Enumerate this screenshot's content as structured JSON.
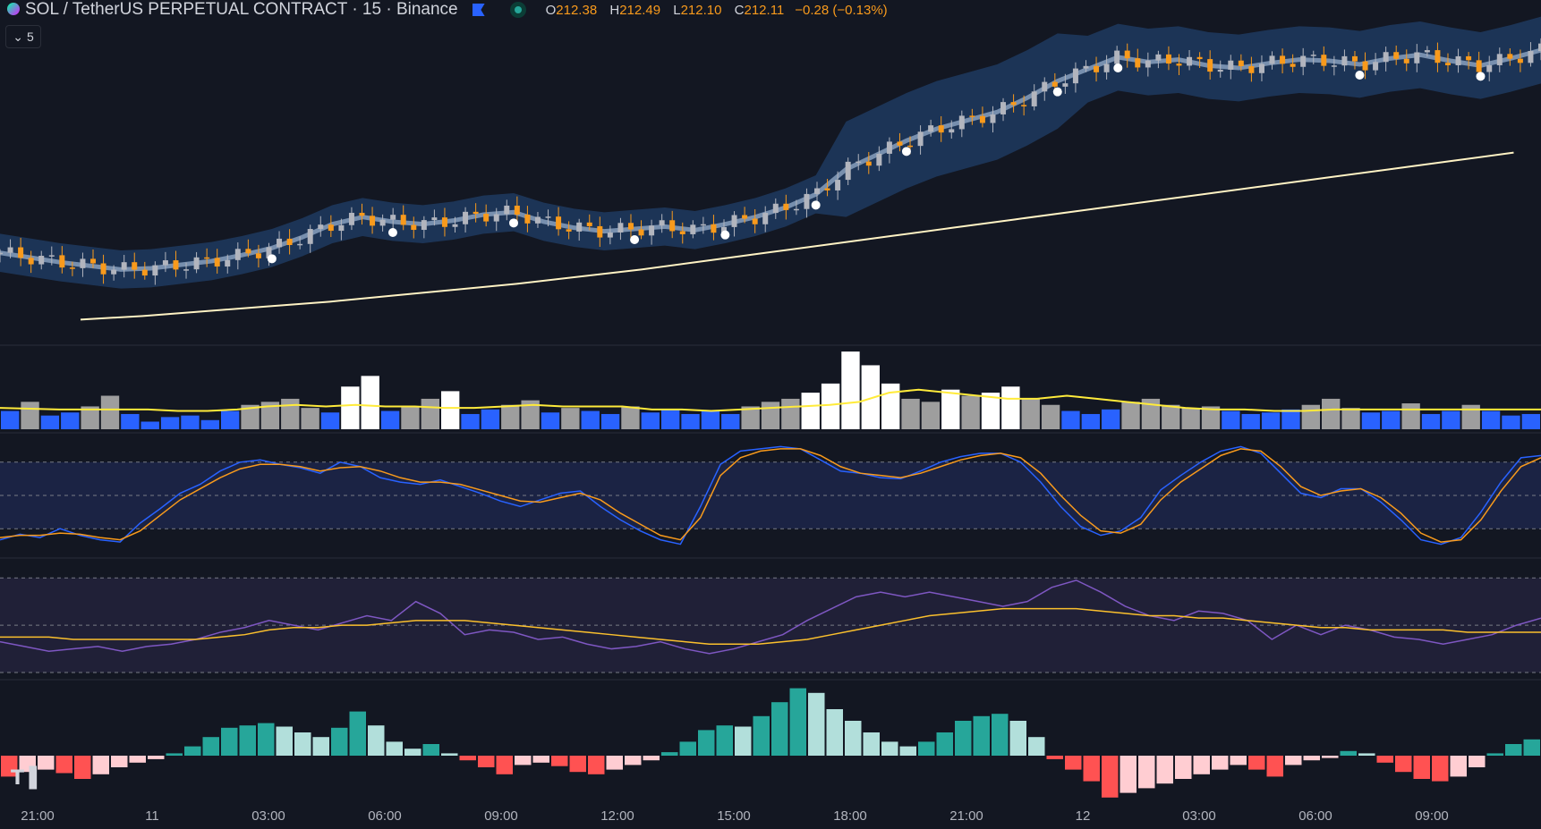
{
  "header": {
    "title": "SOL / TetherUS PERPETUAL CONTRACT · 15 · Binance",
    "open_label": "O",
    "open": "212.38",
    "high_label": "H",
    "high": "212.49",
    "low_label": "L",
    "low": "212.10",
    "close_label": "C",
    "close": "212.11",
    "change": "−0.28 (−0.13%)",
    "collapse_count": "5"
  },
  "colors": {
    "background": "#131722",
    "up_candle": "#b2b5be",
    "down_candle": "#f89a1c",
    "band_fill": "#1e3a5f",
    "ma_long": "#fff3c4",
    "volume_up": "#ffffff",
    "volume_down": "#2962ff",
    "stoch_k": "#2962ff",
    "stoch_d": "#f89a1c",
    "rsi": "#7e57c2",
    "rsi_ma": "#fbc02d",
    "hist_pos_strong": "#26a69a",
    "hist_pos_weak": "#b2dfdb",
    "hist_neg_strong": "#ff5252",
    "hist_neg_weak": "#ffcdd2"
  },
  "chart_data": [
    {
      "type": "line",
      "title": "SOL / TetherUS PERPETUAL CONTRACT · 15 · Binance",
      "x_tick_labels": [
        "21:00",
        "11",
        "03:00",
        "06:00",
        "09:00",
        "12:00",
        "15:00",
        "18:00",
        "21:00",
        "12",
        "03:00",
        "06:00",
        "09:00"
      ],
      "series": [
        {
          "values": [
            196.6,
            196.2,
            195.8,
            195.5,
            195.2,
            195.3,
            195.6,
            195.9,
            196.4,
            197.0,
            197.9,
            199.0,
            199.6,
            199.2,
            199.0,
            199.3,
            199.8,
            200.0,
            199.2,
            198.7,
            198.4,
            198.6,
            198.8,
            198.5,
            199.0,
            199.6,
            200.4,
            201.5,
            203.6,
            204.8,
            206.0,
            207.0,
            207.7,
            208.4,
            209.6,
            211.0,
            212.0,
            213.0,
            212.6,
            212.8,
            212.3,
            212.1,
            212.5,
            212.8,
            212.7,
            212.4,
            212.9,
            213.2,
            212.7,
            212.3,
            212.9,
            213.6
          ]
        },
        {
          "values": [
            191.0,
            191.3,
            191.7,
            192.1,
            192.5,
            193.0,
            193.5,
            194.0,
            194.6,
            195.2,
            195.9,
            196.6,
            197.3,
            198.0,
            198.7,
            199.4,
            200.1,
            200.8,
            201.5,
            202.2,
            202.9,
            203.6,
            204.3,
            205.0
          ]
        }
      ]
    },
    {
      "type": "bar",
      "series": [
        {
          "values": [
            1.2,
            1.8,
            0.9,
            1.1,
            1.5,
            2.2,
            1.0,
            0.5,
            0.8,
            0.9,
            0.6,
            1.2,
            1.6,
            1.8,
            2.0,
            1.4,
            1.1,
            2.8,
            3.5,
            1.2,
            1.5,
            2.0,
            2.5,
            1.0,
            1.3,
            1.6,
            1.9,
            1.1,
            1.4,
            1.2,
            1.0,
            1.5,
            1.1,
            1.3,
            1.0,
            1.2,
            1.0,
            1.5,
            1.8,
            2.0,
            2.4,
            3.0,
            5.1,
            4.2,
            3.0,
            2.0,
            1.8,
            2.6,
            2.2,
            2.4,
            2.8,
            2.0,
            1.6,
            1.2,
            1.0,
            1.3,
            1.8,
            2.0,
            1.6,
            1.4,
            1.5,
            1.2,
            1.0,
            1.1,
            1.3,
            1.6,
            2.0,
            1.4,
            1.1,
            1.2,
            1.7,
            1.0,
            1.2,
            1.6,
            1.2,
            0.9,
            1.0
          ]
        },
        {
          "values": [
            1.4,
            1.35,
            1.3,
            1.3,
            1.3,
            1.3,
            1.2,
            1.2,
            1.3,
            1.5,
            1.6,
            1.5,
            1.6,
            1.5,
            1.5,
            1.4,
            1.4,
            1.5,
            1.6,
            1.5,
            1.5,
            1.5,
            1.3,
            1.3,
            1.2,
            1.3,
            1.4,
            1.5,
            1.6,
            1.8,
            2.4,
            2.6,
            2.4,
            2.2,
            2.0,
            2.0,
            2.2,
            2.0,
            1.8,
            1.6,
            1.4,
            1.3,
            1.3,
            1.2,
            1.2,
            1.3,
            1.3,
            1.3,
            1.3,
            1.3,
            1.3,
            1.3,
            1.3
          ]
        }
      ]
    },
    {
      "type": "line",
      "series": [
        {
          "values": [
            10,
            15,
            12,
            20,
            14,
            10,
            8,
            25,
            38,
            52,
            60,
            72,
            80,
            82,
            78,
            75,
            70,
            80,
            76,
            66,
            62,
            60,
            64,
            58,
            52,
            45,
            40,
            46,
            52,
            54,
            40,
            28,
            18,
            10,
            6,
            40,
            78,
            90,
            92,
            94,
            92,
            82,
            72,
            70,
            66,
            65,
            72,
            80,
            85,
            88,
            88,
            80,
            62,
            40,
            22,
            14,
            18,
            30,
            55,
            68,
            80,
            90,
            94,
            88,
            70,
            52,
            48,
            56,
            56,
            44,
            28,
            10,
            6,
            12,
            35,
            62,
            84,
            86
          ]
        },
        {
          "values": [
            12,
            14,
            14,
            16,
            15,
            12,
            10,
            18,
            32,
            46,
            56,
            66,
            74,
            78,
            78,
            76,
            72,
            75,
            76,
            72,
            66,
            62,
            62,
            60,
            55,
            50,
            45,
            44,
            48,
            52,
            46,
            34,
            24,
            14,
            10,
            30,
            68,
            84,
            90,
            92,
            92,
            86,
            76,
            70,
            68,
            66,
            70,
            76,
            82,
            86,
            88,
            84,
            70,
            50,
            32,
            18,
            16,
            24,
            46,
            62,
            74,
            86,
            92,
            90,
            76,
            58,
            50,
            54,
            56,
            48,
            34,
            16,
            8,
            10,
            28,
            54,
            76,
            84
          ]
        }
      ]
    },
    {
      "type": "line",
      "series": [
        {
          "values": [
            43,
            41,
            39,
            40,
            41,
            39,
            41,
            42,
            44,
            47,
            49,
            52,
            50,
            48,
            51,
            54,
            52,
            60,
            55,
            46,
            48,
            47,
            44,
            45,
            42,
            40,
            41,
            43,
            40,
            38,
            40,
            43,
            46,
            52,
            57,
            62,
            64,
            62,
            64,
            62,
            60,
            58,
            60,
            66,
            69,
            64,
            58,
            54,
            52,
            56,
            55,
            52,
            44,
            50,
            46,
            50,
            48,
            45,
            44,
            42,
            44,
            46,
            50,
            53
          ]
        },
        {
          "values": [
            45,
            45,
            45,
            44,
            44,
            44,
            44,
            44,
            44,
            45,
            46,
            48,
            49,
            49,
            50,
            50,
            51,
            52,
            52,
            52,
            51,
            50,
            49,
            48,
            47,
            46,
            45,
            44,
            43,
            42,
            42,
            42,
            43,
            44,
            46,
            48,
            50,
            52,
            54,
            55,
            56,
            57,
            57,
            57,
            57,
            56,
            55,
            54,
            54,
            53,
            53,
            52,
            51,
            50,
            49,
            49,
            48,
            48,
            48,
            48,
            47,
            47,
            47,
            47
          ]
        }
      ]
    },
    {
      "type": "bar",
      "series": [
        {
          "values": [
            -1.8,
            -1.4,
            -1.2,
            -1.5,
            -2.0,
            -1.6,
            -1.0,
            -0.6,
            -0.3,
            0.2,
            0.8,
            1.6,
            2.4,
            2.6,
            2.8,
            2.5,
            2.0,
            1.6,
            2.4,
            3.8,
            2.6,
            1.2,
            0.6,
            1.0,
            0.2,
            -0.4,
            -1.0,
            -1.6,
            -0.8,
            -0.6,
            -0.9,
            -1.4,
            -1.6,
            -1.2,
            -0.8,
            -0.4,
            0.3,
            1.2,
            2.2,
            2.6,
            2.5,
            3.4,
            4.6,
            5.8,
            5.4,
            4.0,
            3.0,
            2.0,
            1.2,
            0.8,
            1.2,
            2.0,
            3.0,
            3.4,
            3.6,
            3.0,
            1.6,
            -0.3,
            -1.2,
            -2.2,
            -3.6,
            -3.2,
            -2.8,
            -2.4,
            -2.0,
            -1.6,
            -1.2,
            -0.8,
            -1.2,
            -1.8,
            -0.8,
            -0.4,
            -0.2,
            0.4,
            0.2,
            -0.6,
            -1.4,
            -2.0,
            -2.2,
            -1.8,
            -1.0,
            0.2,
            1.0,
            1.4
          ]
        }
      ]
    }
  ]
}
